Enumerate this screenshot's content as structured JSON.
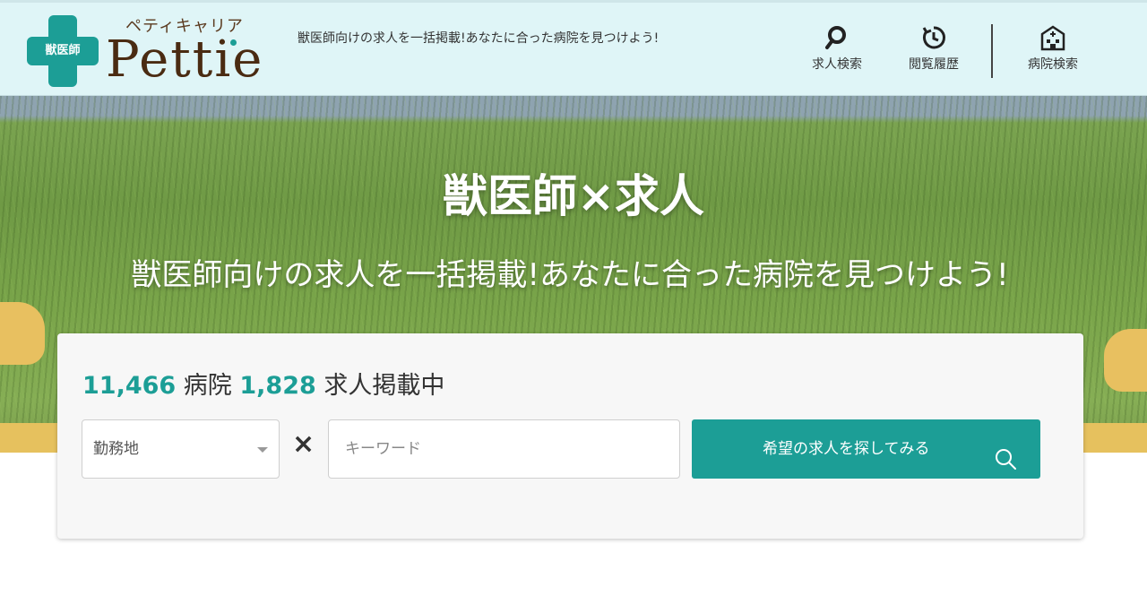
{
  "header": {
    "logo_kana": "ペティキャリア",
    "logo_badge": "獣医師",
    "logo_word": "Pettie",
    "tagline": "獣医師向けの求人を一括掲載!あなたに合った病院を見つけよう!",
    "nav": {
      "search": "求人検索",
      "history": "閲覧履歴",
      "hospital": "病院検索"
    }
  },
  "hero": {
    "title": "獣医師×求人",
    "subtitle": "獣医師向けの求人を一括掲載!あなたに合った病院を見つけよう!"
  },
  "search": {
    "hospital_count": "11,466",
    "hospital_label": "病院",
    "job_count": "1,828",
    "job_label": "求人掲載中",
    "location_select": "勤務地",
    "times_symbol": "×",
    "keyword_placeholder": "キーワード",
    "button_label": "希望の求人を探してみる"
  },
  "colors": {
    "brand_teal": "#1c9e96",
    "header_bg": "#dff5f7",
    "logo_brown": "#4a2b12"
  },
  "icons": [
    "search-icon",
    "history-clock-icon",
    "hospital-icon",
    "chevron-down-icon"
  ]
}
